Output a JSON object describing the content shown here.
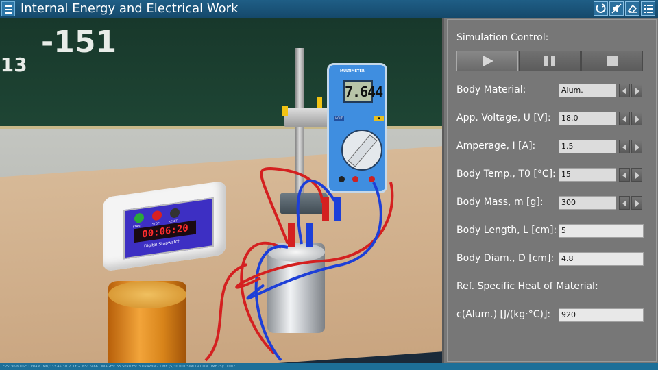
{
  "app": {
    "title": "Internal Energy and Electrical Work"
  },
  "toolbar": {
    "icons": [
      "menu-icon",
      "reset-view-icon",
      "mute-icon",
      "eraser-icon",
      "settings-list-icon"
    ]
  },
  "scene": {
    "chalkboard_text": "-151",
    "chalkboard_fraction": ".13",
    "multimeter": {
      "brand": "MULTIMETER",
      "reading": "7.644",
      "hold_label": "HOLD",
      "com_label": "COM"
    },
    "stopwatch": {
      "display": "00:06:20",
      "label": "Digital Stopwatch",
      "start": "START",
      "stop": "STOP",
      "reset": "RESET"
    }
  },
  "statusbar": {
    "text": "FPS: 96.6 USED VRAM (MB): 33.45 3D POLYGONS: 74661 IMAGES: 55 SPRITES: 3 DRAWING TIME (S): 0.007 SIMULATION TIME (S): 0.002"
  },
  "panel": {
    "simulation_control_label": "Simulation Control:",
    "rows": [
      {
        "label": "Body Material:",
        "value": "Alum.",
        "has_arrows": true
      },
      {
        "label": "App. Voltage, U [V]:",
        "value": "18.0",
        "has_arrows": true
      },
      {
        "label": "Amperage, I [A]:",
        "value": "1.5",
        "has_arrows": true
      },
      {
        "label": "Body Temp., T0 [°C]:",
        "value": "15",
        "has_arrows": true
      },
      {
        "label": "Body Mass, m [g]:",
        "value": "300",
        "has_arrows": true
      },
      {
        "label": "Body Length, L [cm]:",
        "value": "5",
        "has_arrows": false
      },
      {
        "label": "Body Diam., D [cm]:",
        "value": "4.8",
        "has_arrows": false
      }
    ],
    "ref_heat_label": "Ref. Specific Heat of Material:",
    "specific_heat": {
      "label": "c(Alum.) [J/(kg·°C)]:",
      "value": "920"
    }
  }
}
